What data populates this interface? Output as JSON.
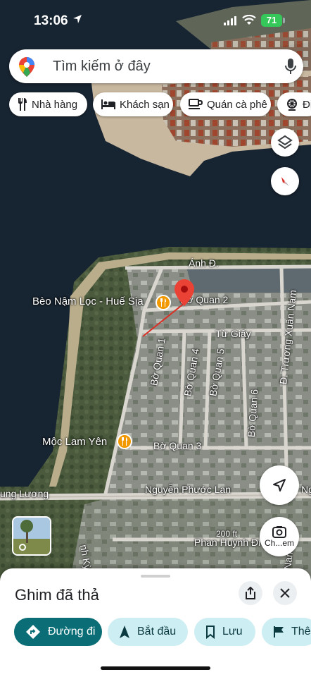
{
  "status": {
    "time": "13:06",
    "battery": "71"
  },
  "search": {
    "placeholder": "Tìm kiếm ở đây"
  },
  "chips": [
    "Nhà hàng",
    "Khách sạn",
    "Quán cà phê",
    "Đị"
  ],
  "map": {
    "labels": {
      "anh": "Ánh Đ.",
      "beo": "Bèo Nậm Lọc - Huế Sịa",
      "bo_quan_2": "Bờ Quan 2",
      "tu_giay": "Từ Giấy",
      "bo_quan_1": "Bờ Quan 1",
      "bo_quan_4": "Bờ Quan 4",
      "bo_quan_5": "Bờ Quan 5",
      "truong_xuan_nam": "Đ. Trương Xuân Nam",
      "bo_quan_6": "Bờ Quan 6",
      "moc_lam_yen": "Mộc Lam Yên",
      "bo_quan_3": "Bờ Quan 3",
      "ung_luong": "ung Lương",
      "nguyen_phuoc_lan": "Nguyễn Phước Lan",
      "phan_huynh": "Phan Huỳnh Đi",
      "scale": "200 ft",
      "nh_ky": "nh Kỳ",
      "nam": "Nam",
      "ng": "Ng"
    },
    "chat_label": "Ch...em"
  },
  "sheet": {
    "title": "Ghim đã thả",
    "actions": [
      "Đường đi",
      "Bắt đầu",
      "Lưu",
      "Thê"
    ]
  }
}
